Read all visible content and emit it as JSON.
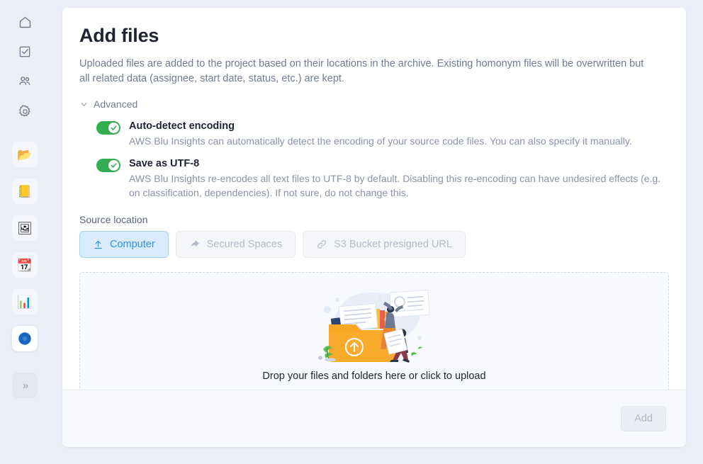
{
  "sidebar": {
    "nav_icons": [
      {
        "name": "home-icon",
        "label": "Home"
      },
      {
        "name": "tasks-icon",
        "label": "Tasks"
      },
      {
        "name": "users-icon",
        "label": "Users"
      },
      {
        "name": "gear-icon",
        "label": "Settings"
      }
    ],
    "app_tiles": [
      {
        "name": "folder-app",
        "glyph": "📂",
        "active": false
      },
      {
        "name": "files-app",
        "glyph": "📒",
        "active": false
      },
      {
        "name": "images-app",
        "glyph": "🖼",
        "active": false
      },
      {
        "name": "calendar-app",
        "glyph": "📆",
        "active": false
      },
      {
        "name": "charts-app",
        "glyph": "📊",
        "active": false
      },
      {
        "name": "globe-app",
        "glyph": "🌐",
        "active": true
      }
    ],
    "collapse_label": "»"
  },
  "page": {
    "title": "Add files",
    "intro": "Uploaded files are added to the project based on their locations in the archive. Existing homonym files will be overwritten but all related data (assignee, start date, status, etc.) are kept."
  },
  "advanced": {
    "label": "Advanced",
    "expanded": true,
    "options": [
      {
        "title": "Auto-detect encoding",
        "description": "AWS Blu Insights can automatically detect the encoding of your source code files. You can also specify it manually.",
        "enabled": true
      },
      {
        "title": "Save as UTF-8",
        "description": "AWS Blu Insights re-encodes all text files to UTF-8 by default. Disabling this re-encoding can have undesired effects (e.g. on classification, dependencies). If not sure, do not change this.",
        "enabled": true
      }
    ]
  },
  "source_location": {
    "label": "Source location",
    "options": [
      {
        "label": "Computer",
        "icon": "upload-icon",
        "selected": true
      },
      {
        "label": "Secured Spaces",
        "icon": "share-arrow-icon",
        "selected": false
      },
      {
        "label": "S3 Bucket presigned URL",
        "icon": "link-icon",
        "selected": false
      }
    ]
  },
  "dropzone": {
    "text": "Drop your files and folders here or click to upload",
    "illustration": "upload-folder-illustration"
  },
  "footer": {
    "add_label": "Add",
    "add_disabled": true
  },
  "colors": {
    "accent_blue": "#2f8fe0",
    "accent_blue_bg": "#d9ecfd",
    "toggle_green": "#34ad52",
    "folder_orange": "#f5a623",
    "page_bg": "#eceff8"
  }
}
